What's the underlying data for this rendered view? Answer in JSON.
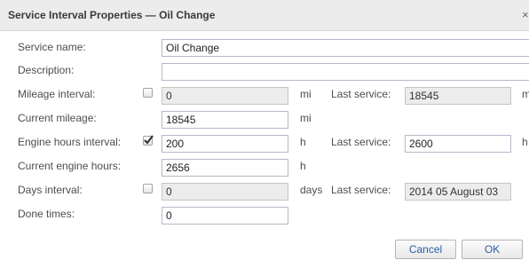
{
  "dialog": {
    "title": "Service Interval Properties — Oil Change",
    "close_glyph": "×"
  },
  "form": {
    "service_name": {
      "label": "Service name:",
      "value": "Oil Change"
    },
    "description": {
      "label": "Description:",
      "value": ""
    },
    "mileage_interval": {
      "label": "Mileage interval:",
      "checked": false,
      "value": "0",
      "unit": "mi",
      "last_label": "Last service:",
      "last_value": "18545",
      "last_unit": "mi"
    },
    "current_mileage": {
      "label": "Current mileage:",
      "value": "18545",
      "unit": "mi"
    },
    "engine_hours_interval": {
      "label": "Engine hours interval:",
      "checked": true,
      "value": "200",
      "unit": "h",
      "last_label": "Last service:",
      "last_value": "2600",
      "last_unit": "h"
    },
    "current_engine_hours": {
      "label": "Current engine hours:",
      "value": "2656",
      "unit": "h"
    },
    "days_interval": {
      "label": "Days interval:",
      "checked": false,
      "value": "0",
      "unit": "days",
      "last_label": "Last service:",
      "last_value": "2014 05 August 03"
    },
    "done_times": {
      "label": "Done times:",
      "value": "0"
    }
  },
  "buttons": {
    "cancel": "Cancel",
    "ok": "OK"
  },
  "colors": {
    "titlebar": "#ececec",
    "disabled_field": "#ececec",
    "button_text": "#2a5ea8"
  }
}
